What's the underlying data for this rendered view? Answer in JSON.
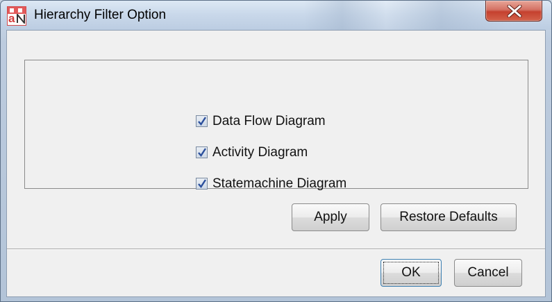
{
  "window": {
    "title": "Hierarchy Filter Option",
    "icon": "app-icon"
  },
  "filters": [
    {
      "label": "Data Flow Diagram",
      "checked": true
    },
    {
      "label": "Activity Diagram",
      "checked": true
    },
    {
      "label": "Statemachine Diagram",
      "checked": true
    }
  ],
  "actions": {
    "apply_label": "Apply",
    "restore_label": "Restore Defaults"
  },
  "dialog_buttons": {
    "ok_label": "OK",
    "cancel_label": "Cancel"
  },
  "colors": {
    "close_button": "#c5412f",
    "checkmark": "#2b4f9c",
    "default_button_border": "#3c7fb1"
  }
}
